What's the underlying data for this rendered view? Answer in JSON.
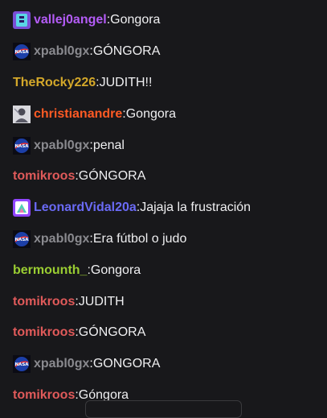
{
  "colors": {
    "background": "#18181b",
    "text": "#efeff1",
    "purple_user": "#b45cf7",
    "gray_user": "#8a8a8f",
    "gold_user": "#d4a82a",
    "orange_user": "#ff5a24",
    "red_user": "#e05a5a",
    "blue_user": "#6a6af5",
    "green_user": "#9acd32"
  },
  "messages": [
    {
      "username": "vallej0angel",
      "text": "Gongora",
      "badge": "logo-badge-icon"
    },
    {
      "username": "xpabl0gx",
      "text": "GÓNGORA",
      "badge": "nasa-badge-icon"
    },
    {
      "username": "TheRocky226",
      "text": "JUDITH!!"
    },
    {
      "username": "christianandre",
      "text": "Gongora",
      "badge": "avatar-badge-icon"
    },
    {
      "username": "xpabl0gx",
      "text": "penal",
      "badge": "nasa-badge-icon"
    },
    {
      "username": "tomikroos",
      "text": "GÓNGORA"
    },
    {
      "username": "LeonardVidal20a",
      "text": "Jajaja la frustración",
      "badge": "emote-badge-icon"
    },
    {
      "username": "xpabl0gx",
      "text": "Era fútbol o judo",
      "badge": "nasa-badge-icon"
    },
    {
      "username": "bermounth_",
      "text": "Gongora"
    },
    {
      "username": "tomikroos",
      "text": "JUDITH"
    },
    {
      "username": "tomikroos",
      "text": "GÓNGORA"
    },
    {
      "username": "xpabl0gx",
      "text": "GONGORA",
      "badge": "nasa-badge-icon"
    },
    {
      "username": "tomikroos",
      "text": "Góngora"
    }
  ]
}
